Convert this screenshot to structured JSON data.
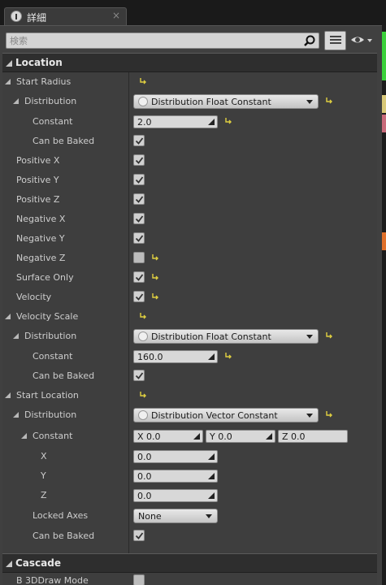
{
  "tab": {
    "title": "詳細",
    "close_glyph": "×"
  },
  "search": {
    "placeholder": "検索",
    "value": ""
  },
  "categories": {
    "location": "Location",
    "cascade": "Cascade"
  },
  "rows": {
    "start_radius": "Start Radius",
    "distribution": "Distribution",
    "constant": "Constant",
    "can_be_baked": "Can be Baked",
    "positive_x": "Positive X",
    "positive_y": "Positive Y",
    "positive_z": "Positive Z",
    "negative_x": "Negative X",
    "negative_y": "Negative Y",
    "negative_z": "Negative Z",
    "surface_only": "Surface Only",
    "velocity": "Velocity",
    "velocity_scale": "Velocity Scale",
    "start_location": "Start Location",
    "x": "X",
    "y": "Y",
    "z": "Z",
    "locked_axes": "Locked Axes",
    "b3d_draw_mode": "B 3DDraw Mode"
  },
  "values": {
    "dist_float": "Distribution Float Constant",
    "dist_vector": "Distribution Vector Constant",
    "start_radius_constant": "2.0",
    "velocity_scale_constant": "160.0",
    "vec_x": "X  0.0",
    "vec_y": "Y  0.0",
    "vec_z": "Z  0.0",
    "x_value": "0.0",
    "y_value": "0.0",
    "z_value": "0.0",
    "locked_axes": "None"
  },
  "checkboxes": {
    "start_radius_can_be_baked": true,
    "positive_x": true,
    "positive_y": true,
    "positive_z": true,
    "negative_x": true,
    "negative_y": true,
    "negative_z": false,
    "surface_only": true,
    "velocity": true,
    "velocity_scale_can_be_baked": true,
    "start_location_can_be_baked": true,
    "b3d_draw_mode": false
  },
  "colors": {
    "panel_bg": "#404040",
    "category_bg": "#2e2e2e",
    "reset_arrow": "#e0d040"
  }
}
